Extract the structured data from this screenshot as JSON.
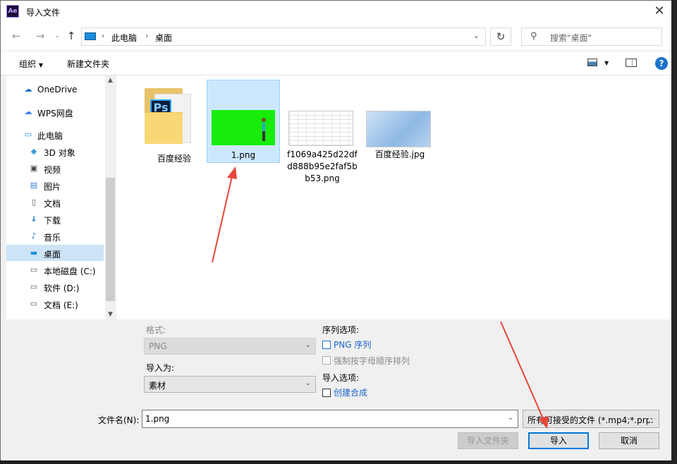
{
  "window": {
    "title": "导入文件",
    "app_icon": "Ae"
  },
  "address": {
    "crumbs": [
      "此电脑",
      "桌面"
    ]
  },
  "search": {
    "placeholder": "搜索\"桌面\""
  },
  "toolbar": {
    "organize": "组织",
    "new_folder": "新建文件夹",
    "help": "?"
  },
  "sidebar": {
    "items": [
      {
        "label": "OneDrive",
        "icon": "cloud-icon"
      },
      {
        "label": "WPS网盘",
        "icon": "cloud-outline-icon"
      },
      {
        "label": "此电脑",
        "icon": "computer-icon"
      },
      {
        "label": "3D 对象",
        "icon": "cube-icon"
      },
      {
        "label": "视频",
        "icon": "video-icon"
      },
      {
        "label": "图片",
        "icon": "image-icon"
      },
      {
        "label": "文档",
        "icon": "document-icon"
      },
      {
        "label": "下载",
        "icon": "download-icon"
      },
      {
        "label": "音乐",
        "icon": "music-icon"
      },
      {
        "label": "桌面",
        "icon": "desktop-icon",
        "selected": true
      },
      {
        "label": "本地磁盘 (C:)",
        "icon": "drive-icon"
      },
      {
        "label": "软件 (D:)",
        "icon": "drive-icon"
      },
      {
        "label": "文档 (E:)",
        "icon": "drive-icon"
      }
    ]
  },
  "files": [
    {
      "name": "百度经验",
      "kind": "folder"
    },
    {
      "name": "1.png",
      "kind": "image",
      "selected": true
    },
    {
      "name": "f1069a425d22dfd888b95e2faf5bb53.png",
      "kind": "image"
    },
    {
      "name": "百度经验.jpg",
      "kind": "image"
    }
  ],
  "options": {
    "format_label": "格式:",
    "format_value": "PNG",
    "import_as_label": "导入为:",
    "import_as_value": "素材",
    "sequence_label": "序列选项:",
    "png_sequence": "PNG 序列",
    "force_alpha": "强制按字母顺序排列",
    "import_options_label": "导入选项:",
    "create_comp": "创建合成"
  },
  "filename": {
    "label": "文件名(N):",
    "value": "1.png"
  },
  "filetype": {
    "value": "所有可接受的文件 (*.mp4;*.prpr"
  },
  "buttons": {
    "import_folder": "导入文件夹",
    "import": "导入",
    "cancel": "取消"
  },
  "colors": {
    "accent": "#0078d7",
    "selection": "#cce8ff",
    "annotation_arrow": "#e8463a"
  }
}
